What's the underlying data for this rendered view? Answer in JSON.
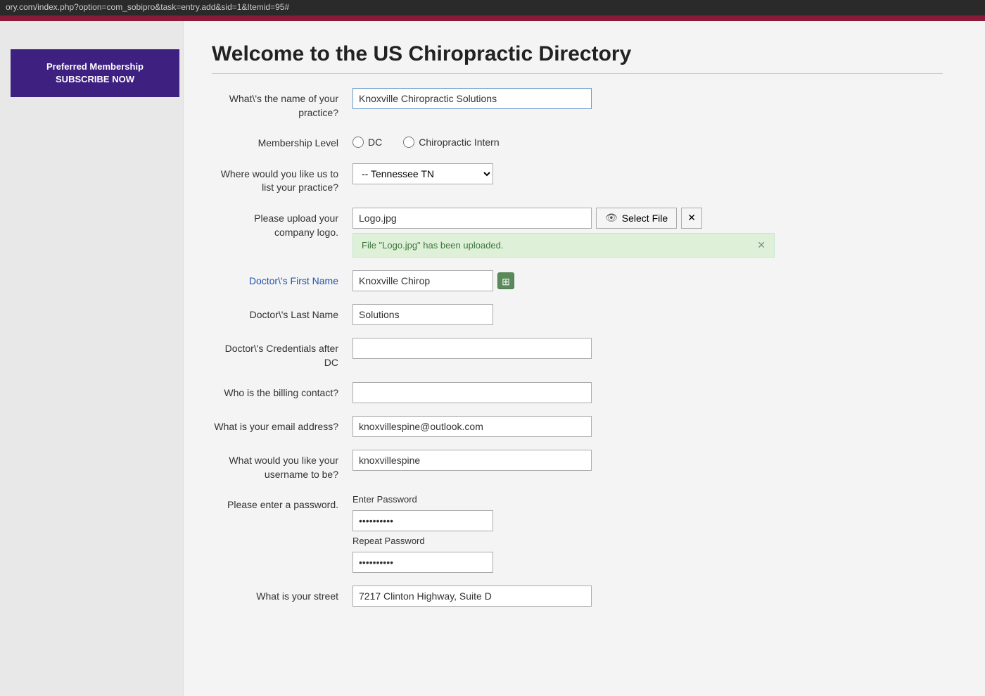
{
  "url_bar": {
    "text": "ory.com/index.php?option=com_sobipro&task=entry.add&sid=1&Itemid=95#"
  },
  "subscribe_button": {
    "line1": "Preferred Membership",
    "line2": "SUBSCRIBE NOW"
  },
  "page": {
    "title": "Welcome to the US Chiropractic Directory"
  },
  "form": {
    "practice_name_label": "What\\'s the name of your practice?",
    "practice_name_value": "Knoxville Chiropractic Solutions",
    "membership_level_label": "Membership Level",
    "membership_dc_label": "DC",
    "membership_intern_label": "Chiropractic Intern",
    "location_label": "Where would you like us to list your practice?",
    "location_value": "-- Tennessee TN",
    "logo_label": "Please upload your company logo.",
    "logo_filename": "Logo.jpg",
    "logo_select_btn": "Select File",
    "logo_success_msg": "File \"Logo.jpg\" has been uploaded.",
    "first_name_label": "Doctor\\'s First Name",
    "first_name_value": "Knoxville Chirop",
    "last_name_label": "Doctor\\'s Last Name",
    "last_name_value": "Solutions",
    "credentials_label": "Doctor\\'s Credentials after DC",
    "credentials_value": "",
    "billing_label": "Who is the billing contact?",
    "billing_value": "",
    "email_label": "What is your email address?",
    "email_value": "knoxvillespine@outlook.com",
    "username_label": "What would you like your username to be?",
    "username_value": "knoxvillespine",
    "password_label": "Please enter a password.",
    "enter_password_label": "Enter Password",
    "password_value": "••••••••••",
    "repeat_password_label": "Repeat Password",
    "repeat_password_value": "••••••••••",
    "street_label": "What is your street",
    "street_value": "7217 Clinton Highway, Suite D"
  }
}
